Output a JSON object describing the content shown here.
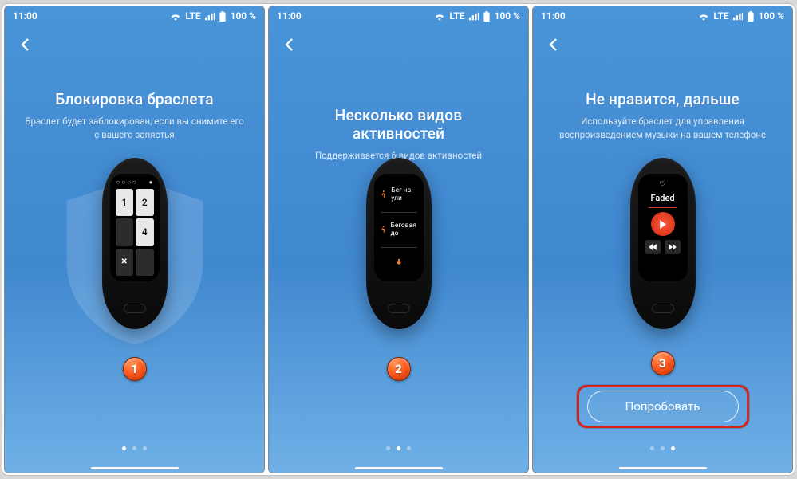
{
  "status": {
    "time": "11:00",
    "net": "LTE",
    "battery": "100 %"
  },
  "screens": [
    {
      "title": "Блокировка браслета",
      "subtitle": "Браслет будет заблокирован, если вы снимите его с вашего запястья",
      "step": "1",
      "dots_active": 0,
      "keypad": {
        "k1": "1",
        "k2": "2",
        "k4": "4",
        "del": "✕"
      }
    },
    {
      "title": "Несколько видов активностей",
      "subtitle": "Поддерживается 6 видов активностей",
      "step": "2",
      "dots_active": 1,
      "activities": {
        "a1": "Бег на ули",
        "a2": "Беговая до"
      }
    },
    {
      "title": "Не нравится, дальше",
      "subtitle": "Используйте браслет для управления воспроизведением музыки на вашем телефоне",
      "step": "3",
      "dots_active": 2,
      "music": {
        "track": "Faded",
        "heart": "♡"
      },
      "cta": "Попробовать"
    }
  ]
}
